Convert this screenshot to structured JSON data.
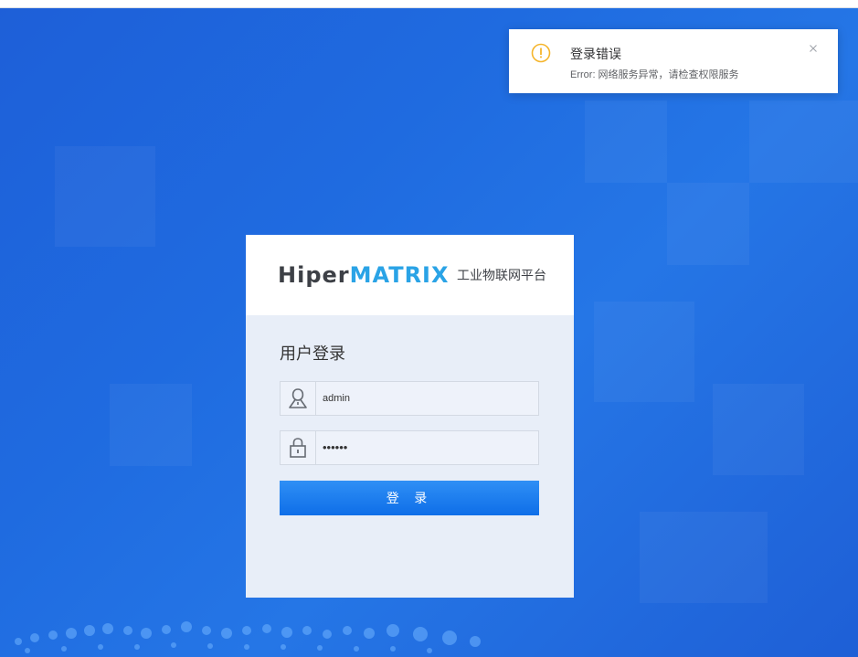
{
  "toast": {
    "icon": "warning-circle-icon",
    "title": "登录错误",
    "message": "Error: 网络服务异常，请检查权限服务",
    "close_icon": "close-icon",
    "accent": "#f5b52c"
  },
  "brand": {
    "logo_part1": "Hiper",
    "logo_part2": "MATRIX",
    "subtitle": "工业物联网平台",
    "colors": {
      "dark": "#3d4046",
      "blue": "#2aa3e6"
    }
  },
  "login": {
    "title": "用户登录",
    "username": {
      "icon": "user-icon",
      "value": "admin"
    },
    "password": {
      "icon": "lock-icon",
      "value": "••••••"
    },
    "submit_label": "登 录"
  },
  "colors": {
    "background": "#1f6be0",
    "button": "#1a7cf0"
  }
}
